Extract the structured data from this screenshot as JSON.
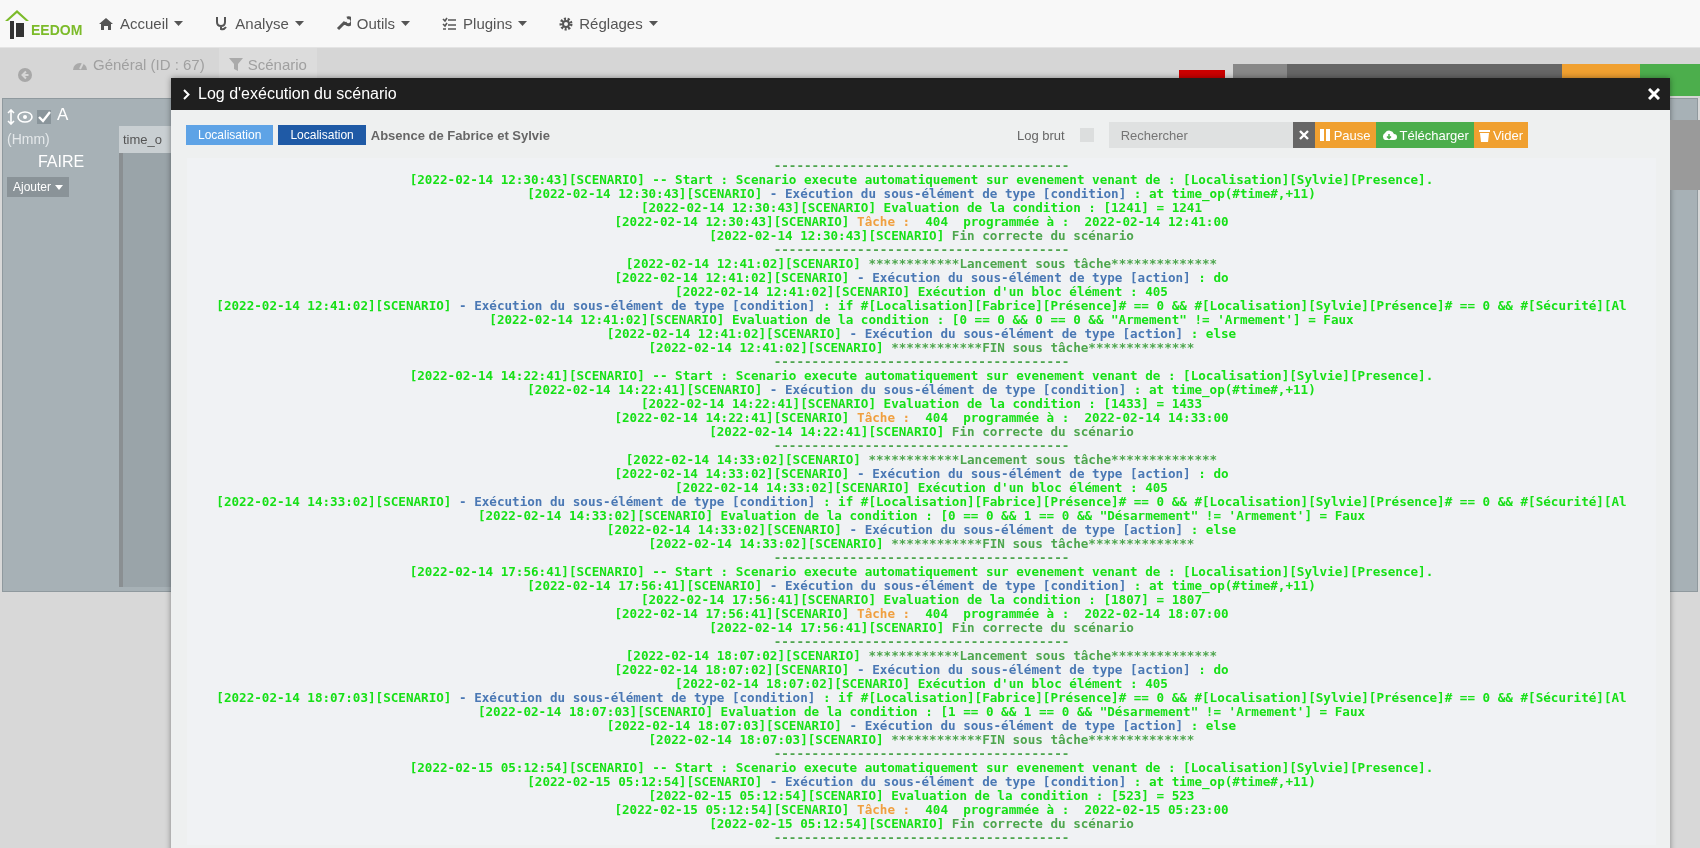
{
  "navbar": {
    "logo": "EEDOM",
    "menus": [
      {
        "label": "Accueil",
        "kind": "home"
      },
      {
        "label": "Analyse",
        "kind": "analysis"
      },
      {
        "label": "Outils",
        "kind": "tools"
      },
      {
        "label": "Plugins",
        "kind": "plugins"
      },
      {
        "label": "Réglages",
        "kind": "settings"
      }
    ]
  },
  "scenario_bar": {
    "tabs": [
      {
        "label": "Général (ID : 67)",
        "kind": "general"
      },
      {
        "label": "Scénario",
        "kind": "scenario"
      }
    ]
  },
  "editor": {
    "block_title": "A",
    "hint": "(Hmm)",
    "section": "FAIRE",
    "add_button": "Ajouter",
    "sub_block_tab": "time_o"
  },
  "modal": {
    "title": "Log d'exécution du scénario",
    "tags": [
      {
        "label": "Localisation",
        "color": "#5ea3e6"
      },
      {
        "label": "Localisation",
        "color": "#1f5aa6"
      }
    ],
    "scenario_name": "Absence de Fabrice et Sylvie",
    "raw_log": {
      "label": "Log brut",
      "checked": false
    },
    "search": {
      "placeholder": "Rechercher"
    },
    "buttons": [
      {
        "label": "Pause",
        "kind": "pause"
      },
      {
        "label": "Télécharger",
        "kind": "download"
      },
      {
        "label": "Vider",
        "kind": "clear"
      }
    ],
    "log": [
      [
        {
          "text": "---------------------------------------",
          "kind": "note"
        }
      ],
      [
        {
          "text": "[2022-02-14 12:30:43][SCENARIO] -- Start : Scenario execute automatiquement sur evenement venant de : [Localisation][Sylvie][Presence].",
          "kind": "text"
        }
      ],
      [
        {
          "text": "[2022-02-14 12:30:43][SCENARIO] ",
          "kind": "text"
        },
        {
          "text": "- Exécution du sous-élément de type [condition]",
          "kind": "info"
        },
        {
          "text": " : at time_op(#time#,+11)",
          "kind": "text"
        }
      ],
      [
        {
          "text": "[2022-02-14 12:30:43][SCENARIO] Evaluation de la condition : [1241] = 1241",
          "kind": "text"
        }
      ],
      [
        {
          "text": "[2022-02-14 12:30:43][SCENARIO] ",
          "kind": "text"
        },
        {
          "text": "Tâche :",
          "kind": "task"
        },
        {
          "text": "  404  programmée à :  2022-02-14 12:41:00",
          "kind": "text"
        }
      ],
      [
        {
          "text": "[2022-02-14 12:30:43][SCENARIO] ",
          "kind": "text"
        },
        {
          "text": "Fin correcte du scénario",
          "kind": "note"
        }
      ],
      [
        {
          "text": "---------------------------------------",
          "kind": "note"
        }
      ],
      [
        {
          "text": "[2022-02-14 12:41:02][SCENARIO] ",
          "kind": "text"
        },
        {
          "text": "************Lancement sous tâche**************",
          "kind": "note"
        }
      ],
      [
        {
          "text": "[2022-02-14 12:41:02][SCENARIO] ",
          "kind": "text"
        },
        {
          "text": "- Exécution du sous-élément de type [action]",
          "kind": "info"
        },
        {
          "text": " : do",
          "kind": "text"
        }
      ],
      [
        {
          "text": "[2022-02-14 12:41:02][SCENARIO] Exécution d'un bloc élément : 405",
          "kind": "text"
        }
      ],
      [
        {
          "text": "[2022-02-14 12:41:02][SCENARIO] ",
          "kind": "text"
        },
        {
          "text": "- Exécution du sous-élément de type [condition]",
          "kind": "info"
        },
        {
          "text": " : if #[Localisation][Fabrice][Présence]# == 0 && #[Localisation][Sylvie][Présence]# == 0 && #[Sécurité][Al",
          "kind": "text"
        }
      ],
      [
        {
          "text": "[2022-02-14 12:41:02][SCENARIO] Evaluation de la condition : [0 == 0 && 0 == 0 && \"Armement\" != 'Armement'] = Faux",
          "kind": "text"
        }
      ],
      [
        {
          "text": "[2022-02-14 12:41:02][SCENARIO] ",
          "kind": "text"
        },
        {
          "text": "- Exécution du sous-élément de type [action]",
          "kind": "info"
        },
        {
          "text": " : else",
          "kind": "text"
        }
      ],
      [
        {
          "text": "[2022-02-14 12:41:02][SCENARIO] ",
          "kind": "text"
        },
        {
          "text": "************FIN sous tâche**************",
          "kind": "note"
        }
      ],
      [
        {
          "text": "---------------------------------------",
          "kind": "note"
        }
      ],
      [
        {
          "text": "[2022-02-14 14:22:41][SCENARIO] -- Start : Scenario execute automatiquement sur evenement venant de : [Localisation][Sylvie][Presence].",
          "kind": "text"
        }
      ],
      [
        {
          "text": "[2022-02-14 14:22:41][SCENARIO] ",
          "kind": "text"
        },
        {
          "text": "- Exécution du sous-élément de type [condition]",
          "kind": "info"
        },
        {
          "text": " : at time_op(#time#,+11)",
          "kind": "text"
        }
      ],
      [
        {
          "text": "[2022-02-14 14:22:41][SCENARIO] Evaluation de la condition : [1433] = 1433",
          "kind": "text"
        }
      ],
      [
        {
          "text": "[2022-02-14 14:22:41][SCENARIO] ",
          "kind": "text"
        },
        {
          "text": "Tâche :",
          "kind": "task"
        },
        {
          "text": "  404  programmée à :  2022-02-14 14:33:00",
          "kind": "text"
        }
      ],
      [
        {
          "text": "[2022-02-14 14:22:41][SCENARIO] ",
          "kind": "text"
        },
        {
          "text": "Fin correcte du scénario",
          "kind": "note"
        }
      ],
      [
        {
          "text": "---------------------------------------",
          "kind": "note"
        }
      ],
      [
        {
          "text": "[2022-02-14 14:33:02][SCENARIO] ",
          "kind": "text"
        },
        {
          "text": "************Lancement sous tâche**************",
          "kind": "note"
        }
      ],
      [
        {
          "text": "[2022-02-14 14:33:02][SCENARIO] ",
          "kind": "text"
        },
        {
          "text": "- Exécution du sous-élément de type [action]",
          "kind": "info"
        },
        {
          "text": " : do",
          "kind": "text"
        }
      ],
      [
        {
          "text": "[2022-02-14 14:33:02][SCENARIO] Exécution d'un bloc élément : 405",
          "kind": "text"
        }
      ],
      [
        {
          "text": "[2022-02-14 14:33:02][SCENARIO] ",
          "kind": "text"
        },
        {
          "text": "- Exécution du sous-élément de type [condition]",
          "kind": "info"
        },
        {
          "text": " : if #[Localisation][Fabrice][Présence]# == 0 && #[Localisation][Sylvie][Présence]# == 0 && #[Sécurité][Al",
          "kind": "text"
        }
      ],
      [
        {
          "text": "[2022-02-14 14:33:02][SCENARIO] Evaluation de la condition : [0 == 0 && 1 == 0 && \"Désarmement\" != 'Armement'] = Faux",
          "kind": "text"
        }
      ],
      [
        {
          "text": "[2022-02-14 14:33:02][SCENARIO] ",
          "kind": "text"
        },
        {
          "text": "- Exécution du sous-élément de type [action]",
          "kind": "info"
        },
        {
          "text": " : else",
          "kind": "text"
        }
      ],
      [
        {
          "text": "[2022-02-14 14:33:02][SCENARIO] ",
          "kind": "text"
        },
        {
          "text": "************FIN sous tâche**************",
          "kind": "note"
        }
      ],
      [
        {
          "text": "---------------------------------------",
          "kind": "note"
        }
      ],
      [
        {
          "text": "[2022-02-14 17:56:41][SCENARIO] -- Start : Scenario execute automatiquement sur evenement venant de : [Localisation][Sylvie][Presence].",
          "kind": "text"
        }
      ],
      [
        {
          "text": "[2022-02-14 17:56:41][SCENARIO] ",
          "kind": "text"
        },
        {
          "text": "- Exécution du sous-élément de type [condition]",
          "kind": "info"
        },
        {
          "text": " : at time_op(#time#,+11)",
          "kind": "text"
        }
      ],
      [
        {
          "text": "[2022-02-14 17:56:41][SCENARIO] Evaluation de la condition : [1807] = 1807",
          "kind": "text"
        }
      ],
      [
        {
          "text": "[2022-02-14 17:56:41][SCENARIO] ",
          "kind": "text"
        },
        {
          "text": "Tâche :",
          "kind": "task"
        },
        {
          "text": "  404  programmée à :  2022-02-14 18:07:00",
          "kind": "text"
        }
      ],
      [
        {
          "text": "[2022-02-14 17:56:41][SCENARIO] ",
          "kind": "text"
        },
        {
          "text": "Fin correcte du scénario",
          "kind": "note"
        }
      ],
      [
        {
          "text": "---------------------------------------",
          "kind": "note"
        }
      ],
      [
        {
          "text": "[2022-02-14 18:07:02][SCENARIO] ",
          "kind": "text"
        },
        {
          "text": "************Lancement sous tâche**************",
          "kind": "note"
        }
      ],
      [
        {
          "text": "[2022-02-14 18:07:02][SCENARIO] ",
          "kind": "text"
        },
        {
          "text": "- Exécution du sous-élément de type [action]",
          "kind": "info"
        },
        {
          "text": " : do",
          "kind": "text"
        }
      ],
      [
        {
          "text": "[2022-02-14 18:07:02][SCENARIO] Exécution d'un bloc élément : 405",
          "kind": "text"
        }
      ],
      [
        {
          "text": "[2022-02-14 18:07:03][SCENARIO] ",
          "kind": "text"
        },
        {
          "text": "- Exécution du sous-élément de type [condition]",
          "kind": "info"
        },
        {
          "text": " : if #[Localisation][Fabrice][Présence]# == 0 && #[Localisation][Sylvie][Présence]# == 0 && #[Sécurité][Al",
          "kind": "text"
        }
      ],
      [
        {
          "text": "[2022-02-14 18:07:03][SCENARIO] Evaluation de la condition : [1 == 0 && 1 == 0 && \"Désarmement\" != 'Armement'] = Faux",
          "kind": "text"
        }
      ],
      [
        {
          "text": "[2022-02-14 18:07:03][SCENARIO] ",
          "kind": "text"
        },
        {
          "text": "- Exécution du sous-élément de type [action]",
          "kind": "info"
        },
        {
          "text": " : else",
          "kind": "text"
        }
      ],
      [
        {
          "text": "[2022-02-14 18:07:03][SCENARIO] ",
          "kind": "text"
        },
        {
          "text": "************FIN sous tâche**************",
          "kind": "note"
        }
      ],
      [
        {
          "text": "---------------------------------------",
          "kind": "note"
        }
      ],
      [
        {
          "text": "[2022-02-15 05:12:54][SCENARIO] -- Start : Scenario execute automatiquement sur evenement venant de : [Localisation][Sylvie][Presence].",
          "kind": "text"
        }
      ],
      [
        {
          "text": "[2022-02-15 05:12:54][SCENARIO] ",
          "kind": "text"
        },
        {
          "text": "- Exécution du sous-élément de type [condition]",
          "kind": "info"
        },
        {
          "text": " : at time_op(#time#,+11)",
          "kind": "text"
        }
      ],
      [
        {
          "text": "[2022-02-15 05:12:54][SCENARIO] Evaluation de la condition : [523] = 523",
          "kind": "text"
        }
      ],
      [
        {
          "text": "[2022-02-15 05:12:54][SCENARIO] ",
          "kind": "text"
        },
        {
          "text": "Tâche :",
          "kind": "task"
        },
        {
          "text": "  404  programmée à :  2022-02-15 05:23:00",
          "kind": "text"
        }
      ],
      [
        {
          "text": "[2022-02-15 05:12:54][SCENARIO] ",
          "kind": "text"
        },
        {
          "text": "Fin correcte du scénario",
          "kind": "note"
        }
      ],
      [
        {
          "text": "---------------------------------------",
          "kind": "note"
        }
      ]
    ]
  }
}
